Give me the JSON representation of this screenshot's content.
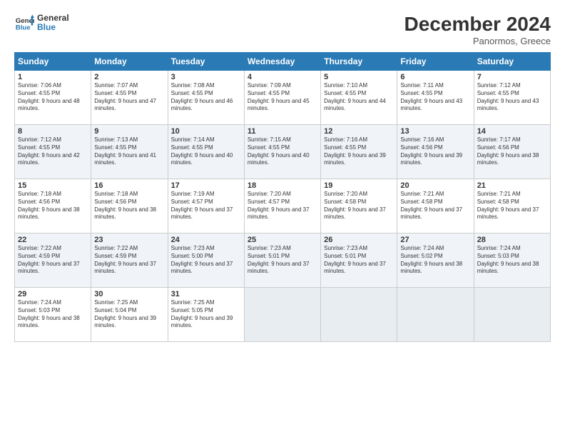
{
  "header": {
    "logo_line1": "General",
    "logo_line2": "Blue",
    "title": "December 2024",
    "subtitle": "Panormos, Greece"
  },
  "days_of_week": [
    "Sunday",
    "Monday",
    "Tuesday",
    "Wednesday",
    "Thursday",
    "Friday",
    "Saturday"
  ],
  "weeks": [
    [
      {
        "day": "1",
        "sunrise": "7:06 AM",
        "sunset": "4:55 PM",
        "daylight": "9 hours and 48 minutes."
      },
      {
        "day": "2",
        "sunrise": "7:07 AM",
        "sunset": "4:55 PM",
        "daylight": "9 hours and 47 minutes."
      },
      {
        "day": "3",
        "sunrise": "7:08 AM",
        "sunset": "4:55 PM",
        "daylight": "9 hours and 46 minutes."
      },
      {
        "day": "4",
        "sunrise": "7:09 AM",
        "sunset": "4:55 PM",
        "daylight": "9 hours and 45 minutes."
      },
      {
        "day": "5",
        "sunrise": "7:10 AM",
        "sunset": "4:55 PM",
        "daylight": "9 hours and 44 minutes."
      },
      {
        "day": "6",
        "sunrise": "7:11 AM",
        "sunset": "4:55 PM",
        "daylight": "9 hours and 43 minutes."
      },
      {
        "day": "7",
        "sunrise": "7:12 AM",
        "sunset": "4:55 PM",
        "daylight": "9 hours and 43 minutes."
      }
    ],
    [
      {
        "day": "8",
        "sunrise": "7:12 AM",
        "sunset": "4:55 PM",
        "daylight": "9 hours and 42 minutes."
      },
      {
        "day": "9",
        "sunrise": "7:13 AM",
        "sunset": "4:55 PM",
        "daylight": "9 hours and 41 minutes."
      },
      {
        "day": "10",
        "sunrise": "7:14 AM",
        "sunset": "4:55 PM",
        "daylight": "9 hours and 40 minutes."
      },
      {
        "day": "11",
        "sunrise": "7:15 AM",
        "sunset": "4:55 PM",
        "daylight": "9 hours and 40 minutes."
      },
      {
        "day": "12",
        "sunrise": "7:16 AM",
        "sunset": "4:55 PM",
        "daylight": "9 hours and 39 minutes."
      },
      {
        "day": "13",
        "sunrise": "7:16 AM",
        "sunset": "4:56 PM",
        "daylight": "9 hours and 39 minutes."
      },
      {
        "day": "14",
        "sunrise": "7:17 AM",
        "sunset": "4:56 PM",
        "daylight": "9 hours and 38 minutes."
      }
    ],
    [
      {
        "day": "15",
        "sunrise": "7:18 AM",
        "sunset": "4:56 PM",
        "daylight": "9 hours and 38 minutes."
      },
      {
        "day": "16",
        "sunrise": "7:18 AM",
        "sunset": "4:56 PM",
        "daylight": "9 hours and 38 minutes."
      },
      {
        "day": "17",
        "sunrise": "7:19 AM",
        "sunset": "4:57 PM",
        "daylight": "9 hours and 37 minutes."
      },
      {
        "day": "18",
        "sunrise": "7:20 AM",
        "sunset": "4:57 PM",
        "daylight": "9 hours and 37 minutes."
      },
      {
        "day": "19",
        "sunrise": "7:20 AM",
        "sunset": "4:58 PM",
        "daylight": "9 hours and 37 minutes."
      },
      {
        "day": "20",
        "sunrise": "7:21 AM",
        "sunset": "4:58 PM",
        "daylight": "9 hours and 37 minutes."
      },
      {
        "day": "21",
        "sunrise": "7:21 AM",
        "sunset": "4:58 PM",
        "daylight": "9 hours and 37 minutes."
      }
    ],
    [
      {
        "day": "22",
        "sunrise": "7:22 AM",
        "sunset": "4:59 PM",
        "daylight": "9 hours and 37 minutes."
      },
      {
        "day": "23",
        "sunrise": "7:22 AM",
        "sunset": "4:59 PM",
        "daylight": "9 hours and 37 minutes."
      },
      {
        "day": "24",
        "sunrise": "7:23 AM",
        "sunset": "5:00 PM",
        "daylight": "9 hours and 37 minutes."
      },
      {
        "day": "25",
        "sunrise": "7:23 AM",
        "sunset": "5:01 PM",
        "daylight": "9 hours and 37 minutes."
      },
      {
        "day": "26",
        "sunrise": "7:23 AM",
        "sunset": "5:01 PM",
        "daylight": "9 hours and 37 minutes."
      },
      {
        "day": "27",
        "sunrise": "7:24 AM",
        "sunset": "5:02 PM",
        "daylight": "9 hours and 38 minutes."
      },
      {
        "day": "28",
        "sunrise": "7:24 AM",
        "sunset": "5:03 PM",
        "daylight": "9 hours and 38 minutes."
      }
    ],
    [
      {
        "day": "29",
        "sunrise": "7:24 AM",
        "sunset": "5:03 PM",
        "daylight": "9 hours and 38 minutes."
      },
      {
        "day": "30",
        "sunrise": "7:25 AM",
        "sunset": "5:04 PM",
        "daylight": "9 hours and 39 minutes."
      },
      {
        "day": "31",
        "sunrise": "7:25 AM",
        "sunset": "5:05 PM",
        "daylight": "9 hours and 39 minutes."
      },
      null,
      null,
      null,
      null
    ]
  ]
}
